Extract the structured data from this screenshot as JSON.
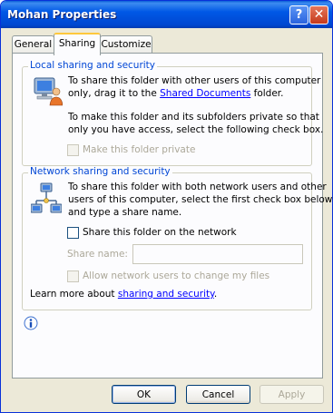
{
  "window": {
    "title": "Mohan Properties"
  },
  "titlebar": {
    "help_label": "?",
    "close_label": "✕"
  },
  "tabs": [
    {
      "label": "General"
    },
    {
      "label": "Sharing"
    },
    {
      "label": "Customize"
    }
  ],
  "local": {
    "legend": "Local sharing and security",
    "text1_a": "To share this folder with other users of this computer",
    "text1_b_pre": "only, drag it to the ",
    "text1_b_link": "Shared Documents",
    "text1_b_post": " folder.",
    "text2_a": "To make this folder and its subfolders private so that",
    "text2_b": "only you have access, select the following check box.",
    "private_label": "Make this folder private",
    "private_checked": false
  },
  "network": {
    "legend": "Network sharing and security",
    "text_a": "To share this folder with both network users and other",
    "text_b": "users of this computer, select the first check box below",
    "text_c": "and type a share name.",
    "share_label": "Share this folder on the network",
    "share_checked": false,
    "sharename_label": "Share name:",
    "sharename_value": "",
    "allow_label": "Allow network users to change my files",
    "allow_checked": false,
    "learn_pre": "Learn more about ",
    "learn_link": "sharing and security",
    "learn_post": "."
  },
  "info_icon": "info-icon",
  "buttons": {
    "ok": "OK",
    "cancel": "Cancel",
    "apply": "Apply"
  },
  "colors": {
    "titlebar": "#0058e6",
    "group_legend": "#0046d5",
    "link": "#0000ff",
    "disabled_text": "#aca899"
  }
}
